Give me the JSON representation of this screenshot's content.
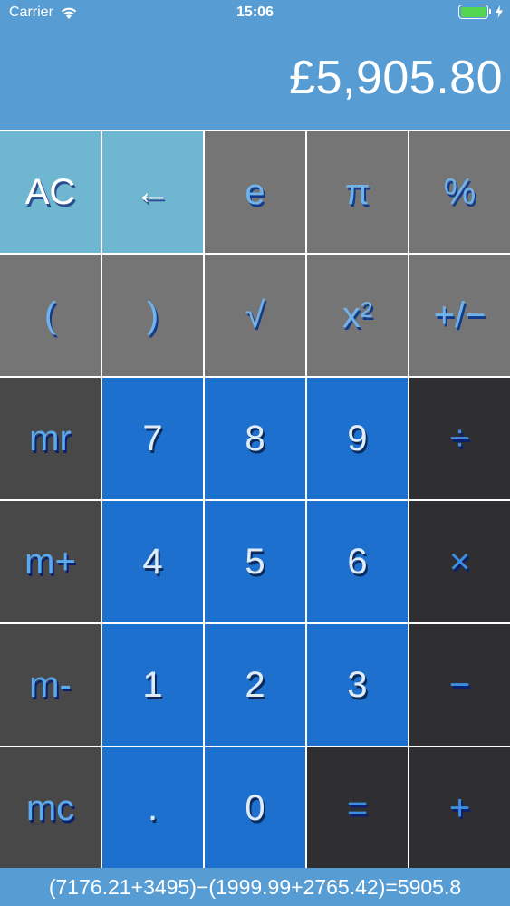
{
  "status_bar": {
    "carrier": "Carrier",
    "time": "15:06",
    "battery_level": 1.0,
    "icons": [
      "wifi-icon",
      "battery-icon",
      "charging-bolt-icon"
    ]
  },
  "display": {
    "value": "£5,905.80"
  },
  "keys": [
    {
      "label": "AC",
      "style": "light"
    },
    {
      "label": "←",
      "style": "light"
    },
    {
      "label": "e",
      "style": "gray"
    },
    {
      "label": "π",
      "style": "gray"
    },
    {
      "label": "%",
      "style": "gray"
    },
    {
      "label": "(",
      "style": "gray"
    },
    {
      "label": ")",
      "style": "gray"
    },
    {
      "label": "√",
      "style": "gray"
    },
    {
      "label": "x²",
      "style": "gray"
    },
    {
      "label": "+/−",
      "style": "gray"
    },
    {
      "label": "mr",
      "style": "dark"
    },
    {
      "label": "7",
      "style": "num"
    },
    {
      "label": "8",
      "style": "num"
    },
    {
      "label": "9",
      "style": "num"
    },
    {
      "label": "÷",
      "style": "op"
    },
    {
      "label": "m+",
      "style": "dark"
    },
    {
      "label": "4",
      "style": "num"
    },
    {
      "label": "5",
      "style": "num"
    },
    {
      "label": "6",
      "style": "num"
    },
    {
      "label": "×",
      "style": "op"
    },
    {
      "label": "m-",
      "style": "dark"
    },
    {
      "label": "1",
      "style": "num"
    },
    {
      "label": "2",
      "style": "num"
    },
    {
      "label": "3",
      "style": "num"
    },
    {
      "label": "−",
      "style": "op"
    },
    {
      "label": "mc",
      "style": "dark"
    },
    {
      "label": ".",
      "style": "num"
    },
    {
      "label": "0",
      "style": "num"
    },
    {
      "label": "=",
      "style": "op"
    },
    {
      "label": "+",
      "style": "op"
    }
  ],
  "history": {
    "expression": "(7176.21+3495)−(1999.99+2765.42)=5905.8"
  },
  "colors": {
    "header_blue": "#579dd3",
    "key_light": "#6fb6d1",
    "key_gray": "#757576",
    "key_dark": "#484848",
    "key_number": "#1e70cf",
    "key_operator": "#2f2e30",
    "battery_green": "#55d651"
  }
}
